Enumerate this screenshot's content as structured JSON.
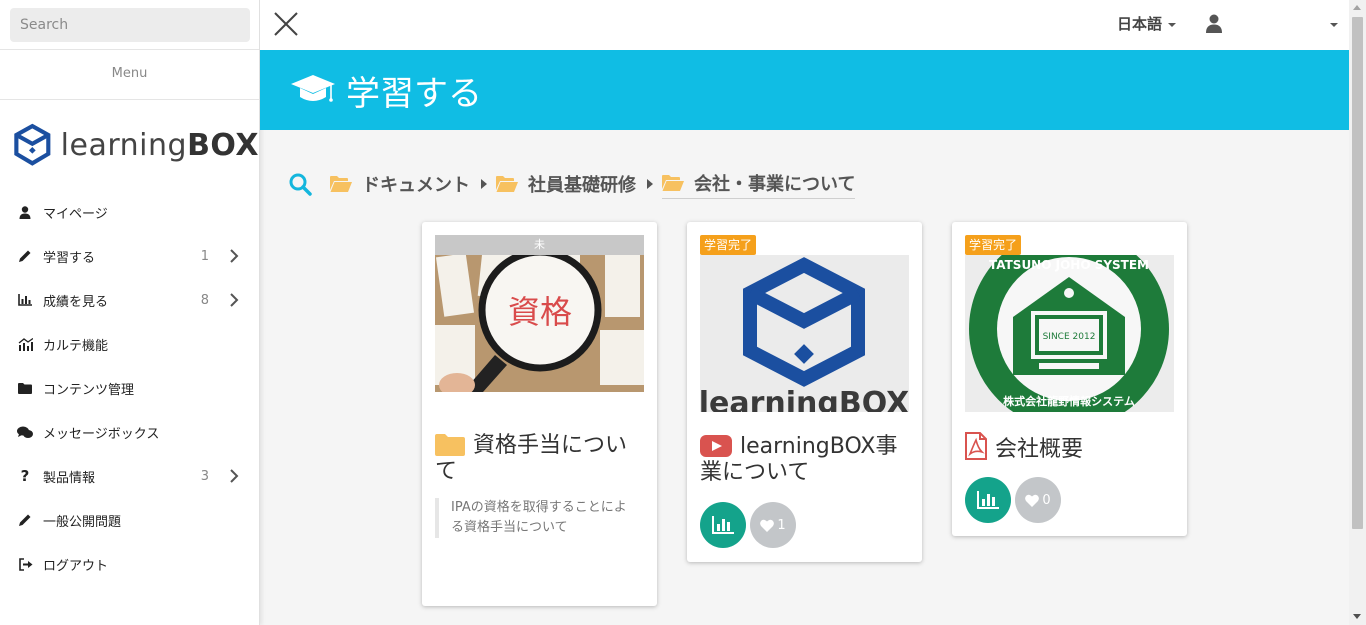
{
  "sidebar": {
    "search_placeholder": "Search",
    "menu_title": "Menu",
    "logo_text_light": "learning",
    "logo_text_bold": "BOX",
    "items": [
      {
        "label": "マイページ",
        "icon": "user-icon",
        "badge": ""
      },
      {
        "label": "学習する",
        "icon": "pencil-icon",
        "badge": "1"
      },
      {
        "label": "成績を見る",
        "icon": "bar-chart-icon",
        "badge": "8"
      },
      {
        "label": "カルテ機能",
        "icon": "chart-line-icon",
        "badge": ""
      },
      {
        "label": "コンテンツ管理",
        "icon": "folder-icon",
        "badge": ""
      },
      {
        "label": "メッセージボックス",
        "icon": "comments-icon",
        "badge": ""
      },
      {
        "label": "製品情報",
        "icon": "question-icon",
        "badge": "3"
      },
      {
        "label": "一般公開問題",
        "icon": "pencil-icon",
        "badge": ""
      },
      {
        "label": "ログアウト",
        "icon": "sign-out-icon",
        "badge": ""
      }
    ]
  },
  "topbar": {
    "language": "日本語"
  },
  "banner": {
    "title": "学習する"
  },
  "breadcrumb": [
    "ドキュメント",
    "社員基礎研修",
    "会社・事業について"
  ],
  "cards": [
    {
      "status": "未",
      "title": "資格手当について",
      "type_icon": "folder-icon",
      "description": "IPAの資格を取得することによる資格手当について",
      "thumbnail_text": "資格"
    },
    {
      "status": "学習完了",
      "title": "learningBOX事業について",
      "type_icon": "youtube-icon",
      "likes": "1",
      "thumbnail_text": "learningBOX"
    },
    {
      "status": "学習完了",
      "title": "会社概要",
      "type_icon": "pdf-icon",
      "likes": "0",
      "thumbnail_text": "TATSUNO JOHO SYSTEM",
      "thumbnail_subtext": "SINCE 2012",
      "thumbnail_bottom": "株式会社龍野情報システム"
    }
  ],
  "colors": {
    "banner": "#10bde4",
    "accent_green": "#14a38b",
    "status_done": "#f5a01b",
    "folder_yellow": "#f7c160",
    "brand_blue": "#1b4fa0"
  }
}
